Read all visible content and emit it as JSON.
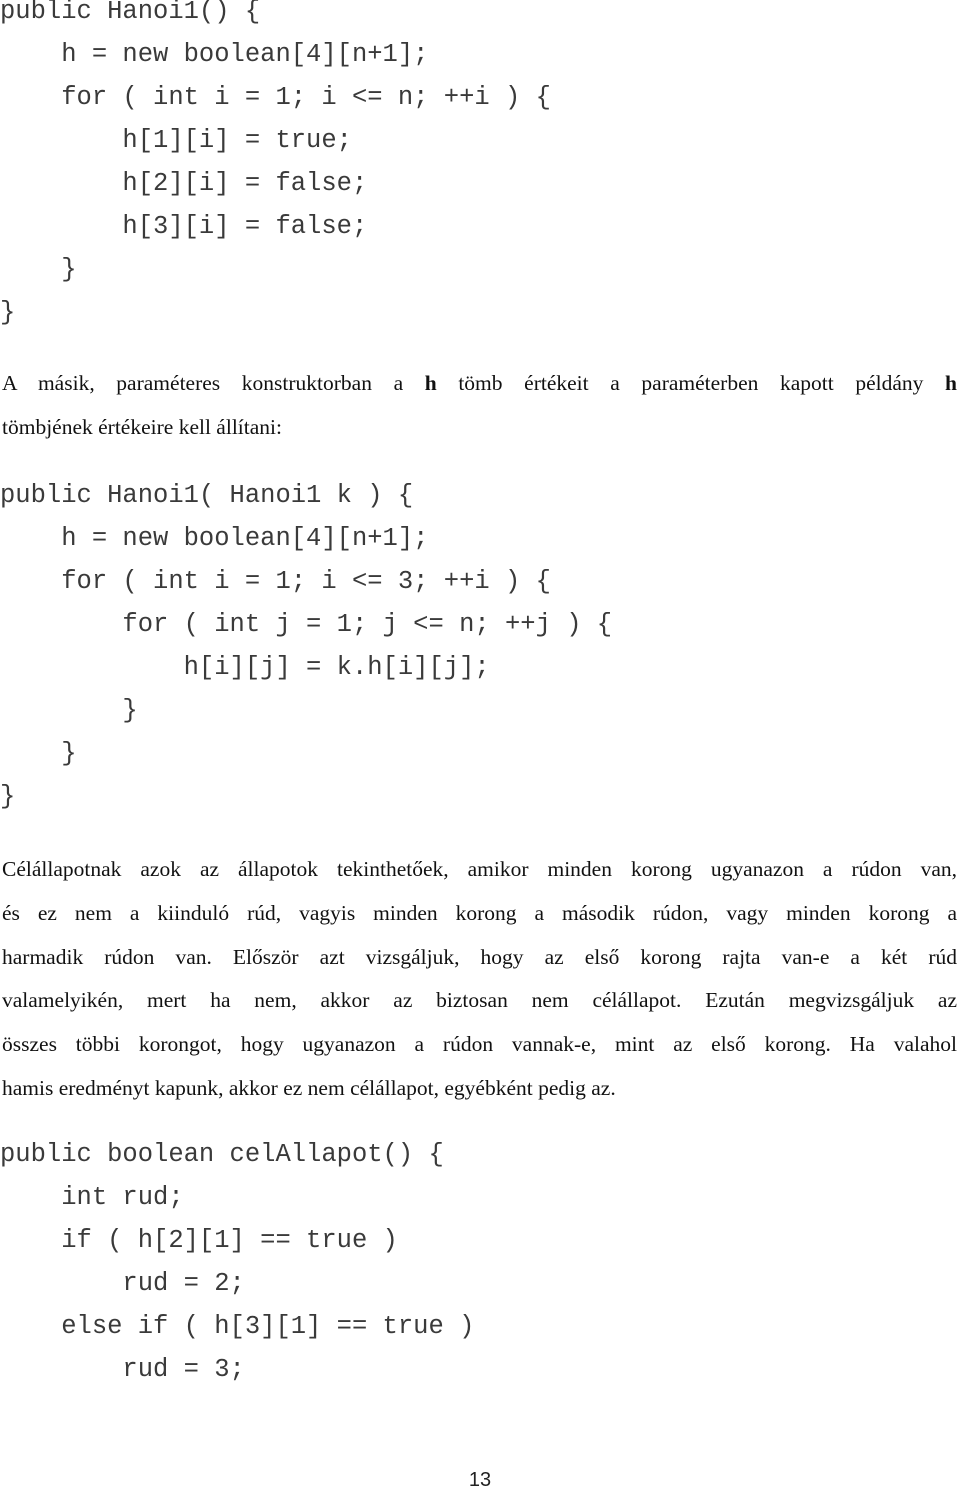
{
  "code_block_1": {
    "lines": [
      "public Hanoi1() {",
      "    h = new boolean[4][n+1];",
      "    for ( int i = 1; i <= n; ++i ) {",
      "        h[1][i] = true;",
      "        h[2][i] = false;",
      "        h[3][i] = false;",
      "    }",
      "}"
    ]
  },
  "paragraph_1": {
    "line1_before_h1": "A másik, paraméteres konstruktorban a ",
    "h1": "h",
    "line1_middle": " tömb értékeit a paraméterben kapott példány ",
    "h2": "h",
    "line2": "tömbjének értékeire kell állítani:"
  },
  "code_block_2": {
    "lines": [
      "public Hanoi1( Hanoi1 k ) {",
      "    h = new boolean[4][n+1];",
      "    for ( int i = 1; i <= 3; ++i ) {",
      "        for ( int j = 1; j <= n; ++j ) {",
      "            h[i][j] = k.h[i][j];",
      "        }",
      "    }",
      "}"
    ]
  },
  "paragraph_2": {
    "lines": [
      "Célállapotnak azok az állapotok tekinthetőek, amikor minden korong ugyanazon a rúdon van,",
      "és ez nem a kiinduló rúd, vagyis minden korong a második rúdon, vagy minden korong a",
      "harmadik rúdon van. Először azt vizsgáljuk, hogy az első korong rajta van-e a két rúd",
      "valamelyikén, mert ha nem, akkor az biztosan nem célállapot. Ezután megvizsgáljuk az",
      "összes többi korongot, hogy ugyanazon a rúdon vannak-e, mint az első korong. Ha valahol",
      "hamis eredményt kapunk, akkor ez nem célállapot, egyébként pedig az."
    ]
  },
  "code_block_3": {
    "lines": [
      "public boolean celAllapot() {",
      "    int rud;",
      "    if ( h[2][1] == true )",
      "        rud = 2;",
      "    else if ( h[3][1] == true )",
      "        rud = 3;"
    ]
  },
  "page_number": "13"
}
